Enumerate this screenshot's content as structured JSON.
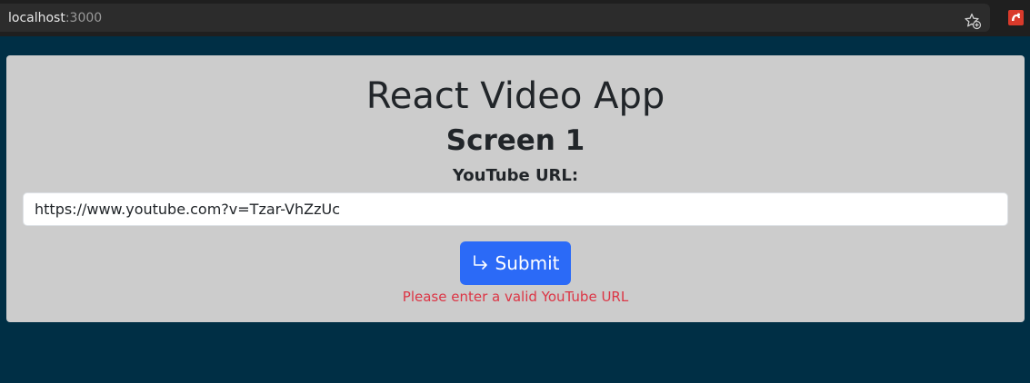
{
  "browser": {
    "url_host": "localhost",
    "url_port": ":3000"
  },
  "app": {
    "title": "React Video App",
    "subtitle": "Screen 1",
    "field_label": "YouTube URL:",
    "input_value": "https://www.youtube.com?v=Tzar-VhZzUc",
    "submit_label": "Submit",
    "error_message": "Please enter a valid YouTube URL"
  },
  "icons": {
    "bookmark": "star-add-icon",
    "extension": "extension-icon",
    "submit": "enter-arrow-icon"
  },
  "colors": {
    "page_background": "#002f45",
    "card_background": "#cccccc",
    "primary_button": "#2b6af7",
    "error": "#dc3545"
  }
}
